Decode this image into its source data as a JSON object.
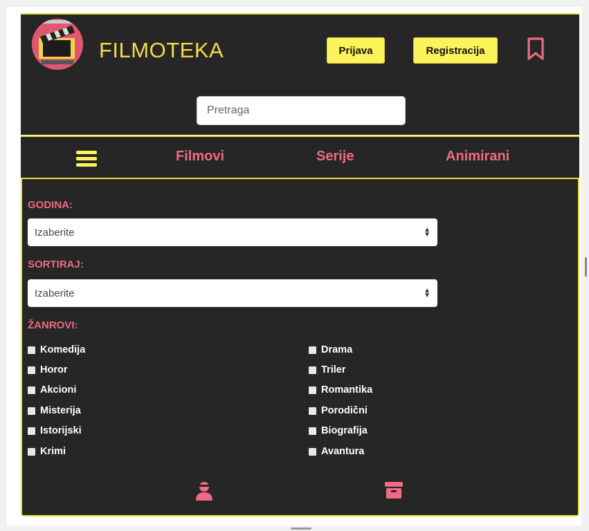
{
  "header": {
    "brand": "FILMOTEKA",
    "login_label": "Prijava",
    "register_label": "Registracija",
    "search_placeholder": "Pretraga",
    "bookmark_icon": "bookmark-icon",
    "logo_icon": "clapperboard-icon"
  },
  "nav": {
    "menu_icon": "hamburger-icon",
    "items": [
      {
        "label": "Filmovi"
      },
      {
        "label": "Serije"
      },
      {
        "label": "Animirani"
      }
    ]
  },
  "filters": {
    "year_label": "GODINA:",
    "year_value": "Izaberite",
    "sort_label": "SORTIRAJ:",
    "sort_value": "Izaberite",
    "genres_label": "ŽANROVI:",
    "genres_left": [
      "Komedija",
      "Horor",
      "Akcioni",
      "Misterija",
      "Istorijski",
      "Krimi"
    ],
    "genres_right": [
      "Drama",
      "Triler",
      "Romantika",
      "Porodični",
      "Biografija",
      "Avantura"
    ],
    "action_icons": [
      "user-remove-icon",
      "archive-icon"
    ]
  },
  "colors": {
    "background": "#262626",
    "accent_yellow": "#fdf35a",
    "accent_pink": "#ef6b84",
    "border_yellow": "#e8e23a"
  }
}
